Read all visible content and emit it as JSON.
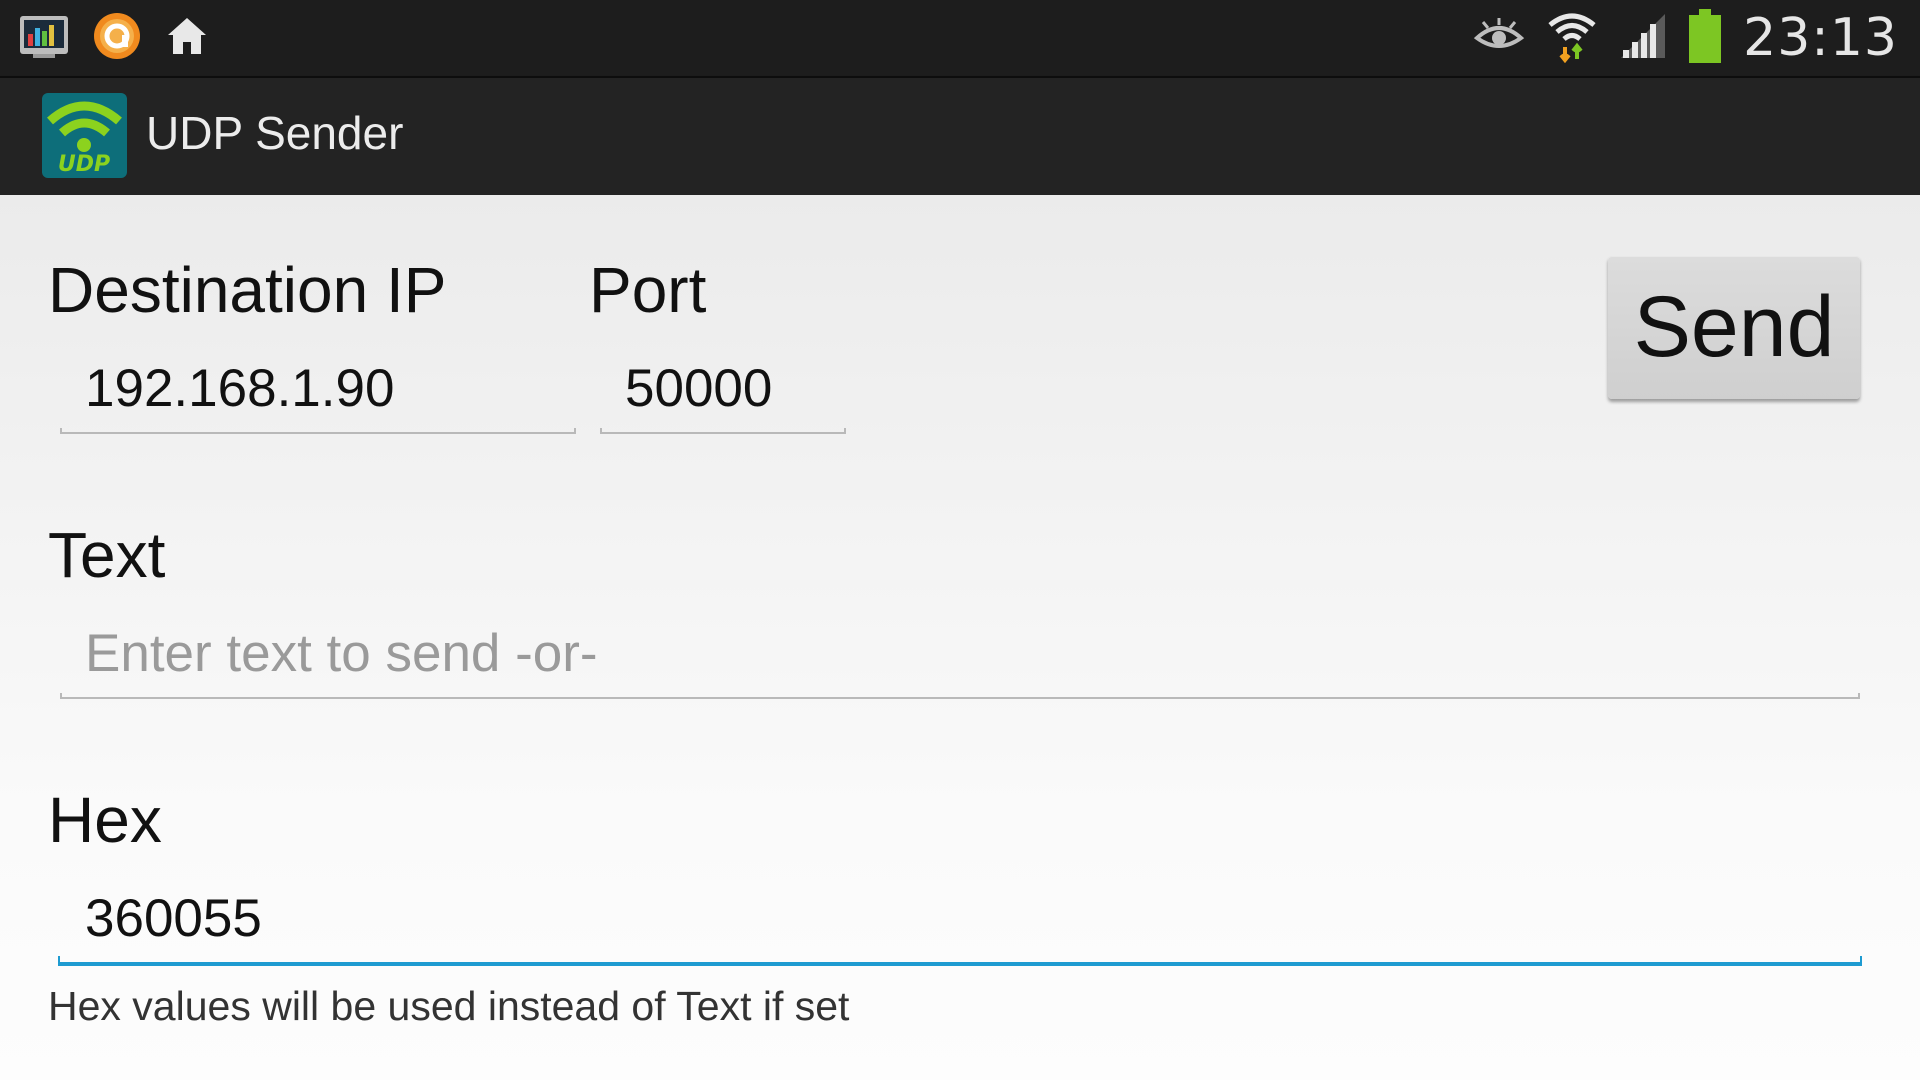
{
  "status_bar": {
    "time": "23:13",
    "left_icons": [
      "task-manager-icon",
      "app-notification-icon",
      "home-icon"
    ],
    "right_icons": [
      "eye-icon",
      "wifi-icon",
      "signal-icon",
      "battery-icon"
    ],
    "colors": {
      "background": "#1d1d1d",
      "battery": "#7dc623"
    }
  },
  "action_bar": {
    "title": "UDP Sender",
    "icon_label": "UDP"
  },
  "form": {
    "destination_ip_label": "Destination IP",
    "destination_ip_value": "192.168.1.90",
    "port_label": "Port",
    "port_value": "50000",
    "send_label": "Send",
    "text_label": "Text",
    "text_placeholder": "Enter text to send -or-",
    "hex_label": "Hex",
    "hex_value": "360055",
    "hex_hint": "Hex values will be used instead of Text if set"
  },
  "colors": {
    "focus_accent": "#1e9bd1",
    "app_icon_green": "#8cd21e",
    "app_icon_teal": "#0d6e7a"
  }
}
